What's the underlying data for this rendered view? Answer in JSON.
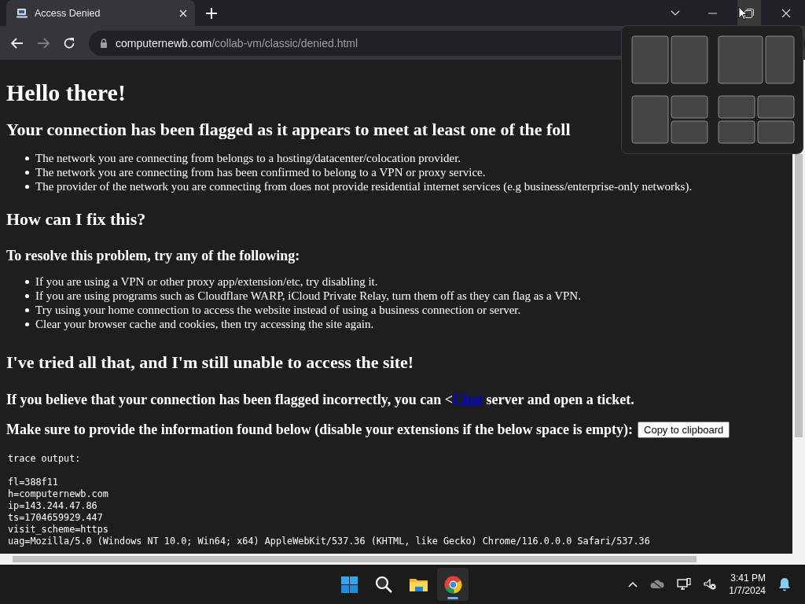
{
  "browser": {
    "tabs": [
      {
        "title": "Access Denied",
        "selected": true
      }
    ],
    "address": {
      "domain": "computernewb.com",
      "path": "/collab-vm/classic/denied.html"
    }
  },
  "page": {
    "title": "Hello there!",
    "sections": [
      {
        "heading": "Your connection has been flagged as it appears to meet at least one of the foll",
        "items": [
          "The network you are connecting from belongs to a hosting/datacenter/colocation provider.",
          "The network you are connecting from has been confirmed to belong to a VPN or proxy service.",
          "The provider of the network you are connecting from does not provide residential internet services (e.g business/enterprise-only networks)."
        ]
      },
      {
        "heading": "How can I fix this?",
        "subheading": "To resolve this problem, try any of the following:",
        "items": [
          "If you are using a VPN or other proxy app/extension/etc, try disabling it.",
          "If you are using programs such as Cloudflare WARP, iCloud Private Relay, turn them off as they can flag as a VPN.",
          "Try using your home connection to access the website instead of using a business connection or server.",
          "Clear your browser cache and cookies, then try accessing the site again."
        ]
      },
      {
        "heading": "I've tried all that, and I'm still unable to access the site!"
      }
    ],
    "contact": {
      "before": "If you believe that your connection has been flagged incorrectly, you can <",
      "link": "Chat",
      "after": " server and open a ticket."
    },
    "info": {
      "text": "Make sure to provide the information found below (disable your extensions if the below space is empty):",
      "button": "Copy to clipboard"
    },
    "trace": {
      "label": "trace output:",
      "lines": [
        "fl=388f11",
        "h=computernewb.com",
        "ip=143.244.47.86",
        "ts=1704659929.447",
        "visit_scheme=https",
        "uag=Mozilla/5.0 (Windows NT 10.0; Win64; x64) AppleWebKit/537.36 (KHTML, like Gecko) Chrome/116.0.0.0 Safari/537.36"
      ]
    }
  },
  "taskbar": {
    "apps": [
      {
        "kind": "start",
        "selected": false
      },
      {
        "kind": "search",
        "selected": false
      },
      {
        "kind": "files",
        "selected": false
      },
      {
        "kind": "browser",
        "selected": true
      }
    ],
    "time": "3:41 PM",
    "date": "1/7/2024"
  }
}
